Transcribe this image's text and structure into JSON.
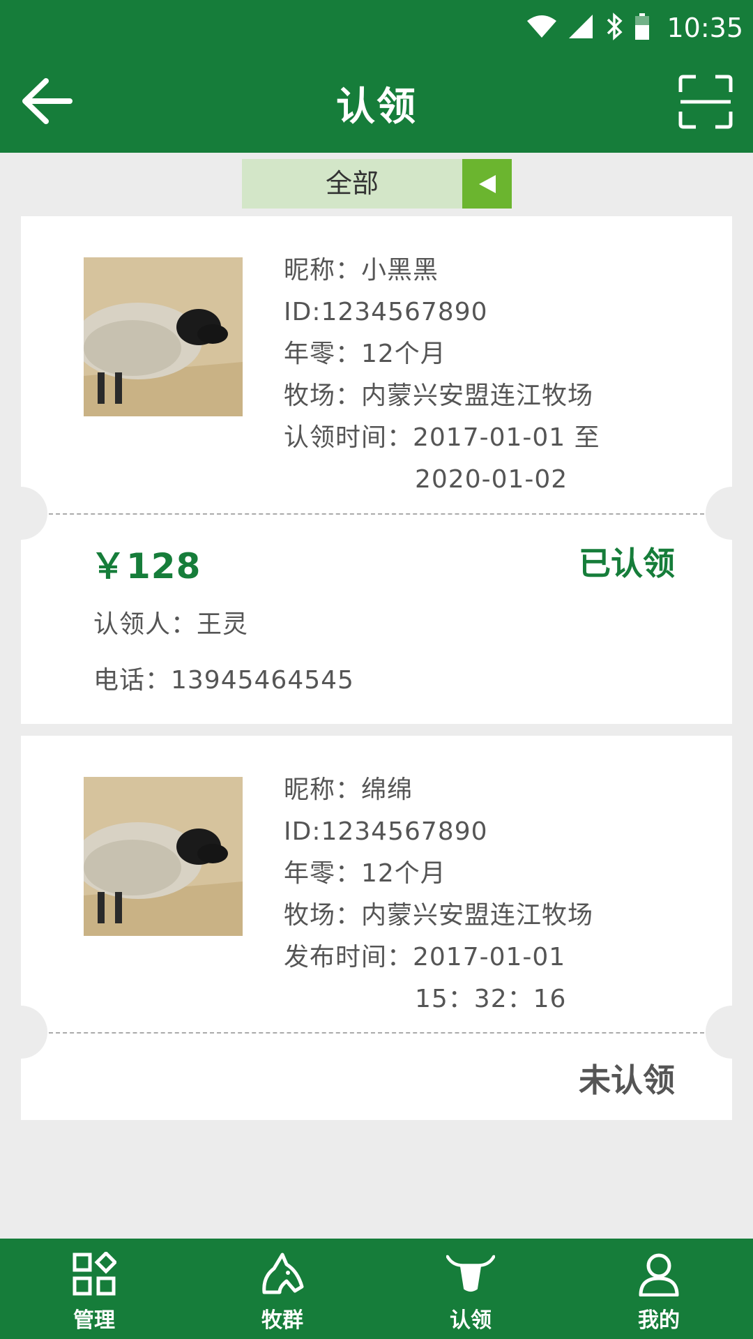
{
  "status_bar": {
    "time": "10:35",
    "icons": [
      "wifi-icon",
      "cell-signal-icon",
      "bluetooth-icon",
      "battery-icon"
    ]
  },
  "header": {
    "title": "认领",
    "back_icon": "back-arrow-icon",
    "scan_icon": "scan-icon"
  },
  "filter": {
    "label": "全部",
    "icon": "triangle-left-icon"
  },
  "cards": [
    {
      "nickname": "昵称：小黑黑",
      "id": "ID:1234567890",
      "age": "年零：12个月",
      "ranch": "牧场：内蒙兴安盟连江牧场",
      "time_label": "认领时间：2017-01-01 至",
      "time_cont": "2020-01-02",
      "price": "￥128",
      "status": "已认领",
      "owner": "认领人：王灵",
      "phone": "电话：13945464545"
    },
    {
      "nickname": "昵称：绵绵",
      "id": "ID:1234567890",
      "age": "年零：12个月",
      "ranch": "牧场：内蒙兴安盟连江牧场",
      "time_label": "发布时间：2017-01-01",
      "time_cont": "15：32：16",
      "status": "未认领"
    }
  ],
  "bottom_nav": [
    {
      "label": "管理",
      "icon": "grid-icon"
    },
    {
      "label": "牧群",
      "icon": "horse-icon"
    },
    {
      "label": "认领",
      "icon": "ox-head-icon"
    },
    {
      "label": "我的",
      "icon": "user-icon"
    }
  ],
  "colors": {
    "primary": "#167d3a",
    "filter_bg": "#d3e6c8",
    "filter_arrow": "#6bb52f",
    "page_bg": "#ececec"
  }
}
